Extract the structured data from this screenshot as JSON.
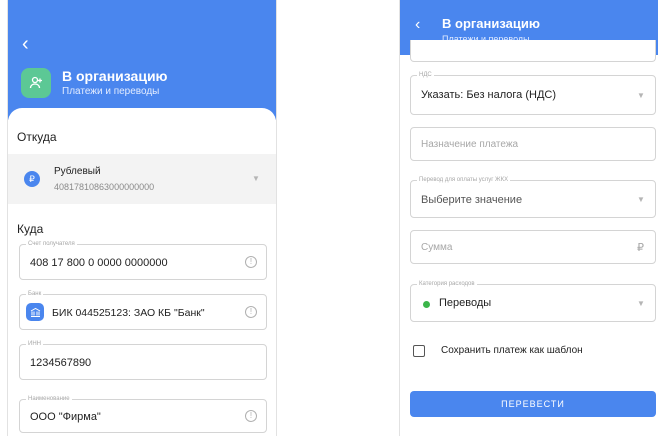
{
  "left": {
    "header": {
      "back_icon": "‹",
      "title": "В организацию",
      "subtitle": "Платежи и переводы"
    },
    "from": {
      "label": "Откуда",
      "account_name": "Рублевый",
      "account_number": "40817810863000000000"
    },
    "to": {
      "label": "Куда",
      "fields": [
        {
          "label": "Счет получателя",
          "value": "408 17 800 0 0000 0000000"
        },
        {
          "label": "Банк",
          "value": "БИК 044525123: ЗАО КБ \"Банк\""
        },
        {
          "label": "ИНН",
          "value": "1234567890"
        },
        {
          "label": "Наименование",
          "value": "ООО \"Фирма\""
        }
      ]
    }
  },
  "right": {
    "header": {
      "back_icon": "‹",
      "title": "В организацию",
      "subtitle": "Платежи и переводы"
    },
    "vat": {
      "label": "НДС",
      "value": "Указать: Без налога (НДС)"
    },
    "purpose": {
      "placeholder": "Назначение платежа"
    },
    "utilities": {
      "label": "Перевод для оплаты услуг ЖКХ",
      "value": "Выберите значение"
    },
    "amount": {
      "placeholder": "Сумма",
      "currency": "₽"
    },
    "category": {
      "label": "Категория расходов",
      "value": "Переводы",
      "dot_color": "#3bb54a"
    },
    "save_template": {
      "label": "Сохранить платеж как шаблон",
      "checked": false
    },
    "submit_label": "ПЕРЕВЕСТИ"
  },
  "colors": {
    "accent": "#4a86ee",
    "org_icon": "#5cc895",
    "field_border": "#d4d4d4"
  }
}
